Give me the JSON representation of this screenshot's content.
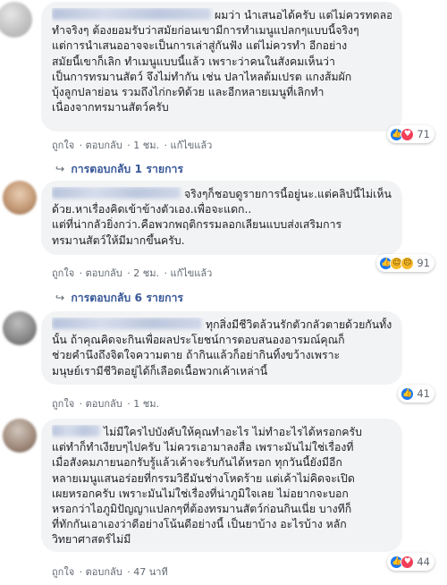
{
  "comments": [
    {
      "lines": [
        "ผมว่า นำเสนอได้ครับ แต่ไม่ควรทดลอง",
        "ทำจริงๆ ต้องยอมรับว่าสมัยก่อนเขามีการทำเมนูแปลกๆแบบนี้จริงๆ",
        "แต่การนำเสนออาจจะเป็นการเล่าสู่กันฟัง แต่ไม่ควรทำ อีกอย่าง",
        "สมัยนี้เขาก็เลิก ทำเมนูแบบนี้แล้ว เพราะว่าคนในสังคมเห็นว่า",
        "เป็นการทรมานสัตว์ จึงไม่ทำกัน เช่น ปลาไหลต้มเปรต แกงส้มผัก",
        "บุ้งลูกปลาย่อน รวมถึงไก่กะทิด้วย และอีกหลายเมนูที่เลิกทำ",
        "เนื่องจากทรมานสัตว์ครับ"
      ],
      "like": "ถูกใจ",
      "reply": "ตอบกลับ",
      "time": "1 ชม.",
      "edited": "แก้ไขแล้ว",
      "reaction_count": "71",
      "replies_label": "การตอบกลับ 1 รายการ"
    },
    {
      "lines": [
        "จริงๆก็ชอบดูรายการนี้อยู่นะ.แต่คลิปนี้ไม่เห็น",
        "ด้วย.หาเรื่องคิดเข้าข้างตัวเอง.เพื่อจะแดก..",
        "แต่ที่น่ากลัวยิ่งกว่า.คือพวกพฤติกรรมลอกเลียนแบบส่งเสริมการ",
        "ทรมานสัตว์ให้มีมากขึ้นครับ."
      ],
      "like": "ถูกใจ",
      "reply": "ตอบกลับ",
      "time": "2 ชม.",
      "edited": "แก้ไขแล้ว",
      "reaction_count": "91",
      "replies_label": "การตอบกลับ 6 รายการ"
    },
    {
      "lines": [
        "ทุกสิ่งมีชีวิตล้วนรักตัวกลัวตายด้วยกันทั้ง",
        "นั้น ถ้าคุณคิดจะกินเพื่อผลประโยชน์การตอบสนองอารมณ์คุณก็",
        "ช่วยคำนึงถึงจิตใจความตาย ถ้ากินแล้วก็อย่ากินทิ้งขว้างเพราะ",
        "มนุษย์เรามีชีวิตอยู่ได้ก็เลือดเนื้อพวกเค้าเหล่านี้"
      ],
      "like": "ถูกใจ",
      "reply": "ตอบกลับ",
      "time": "1 ชม.",
      "reaction_count": "41"
    },
    {
      "lines": [
        "ไม่มีใครไปบังคับให้คุณทำอะไร ไม่ทำอะไรได้หรอกครับ",
        "แต่ทำก็ทำเงียบๆไปครับ ไม่ควรเอามาลงสื่อ เพราะมันไม่ใช่เรื่องที่",
        "เมื่อสังคมภายนอกรับรู้แล้วเค้าจะรับกันได้หรอก ทุกวันนี้ยังมีอีก",
        "หลายเมนูแสนอร่อยที่กรรมวิธีมันช่างโหดร้าย แต่เค้าไม่คิดจะเปิด",
        "เผยหรอกครับ เพราะมันไม่ใช่เรื่องที่น่าภูมิใจเลย ไม่อยากจะบอก",
        "หรอกว่าไอภูมิปัญญาแปลกๆที่ต้องทรมานสัตว์ก่อนกินเนี่ย บางทีก็",
        "ที่ทักกันเอาเองว่าดีอย่างโน้นดีอย่างนี้ เป็นยาบ้าง อะไรบ้าง หลัก",
        "วิทยาศาสตร์ไม่มี"
      ],
      "like": "ถูกใจ",
      "reply": "ตอบกลับ",
      "time": "47 นาที",
      "reaction_count": "44"
    }
  ],
  "icons": {
    "like": "like-icon",
    "love": "love-icon",
    "haha": "haha-icon",
    "sad": "sad-icon",
    "reply_arrow": "reply-arrow-icon"
  },
  "colors": {
    "bubble": "#f2f3f5",
    "link": "#385898",
    "meta": "#606770",
    "like": "#1877f2",
    "love": "#f33e58"
  }
}
